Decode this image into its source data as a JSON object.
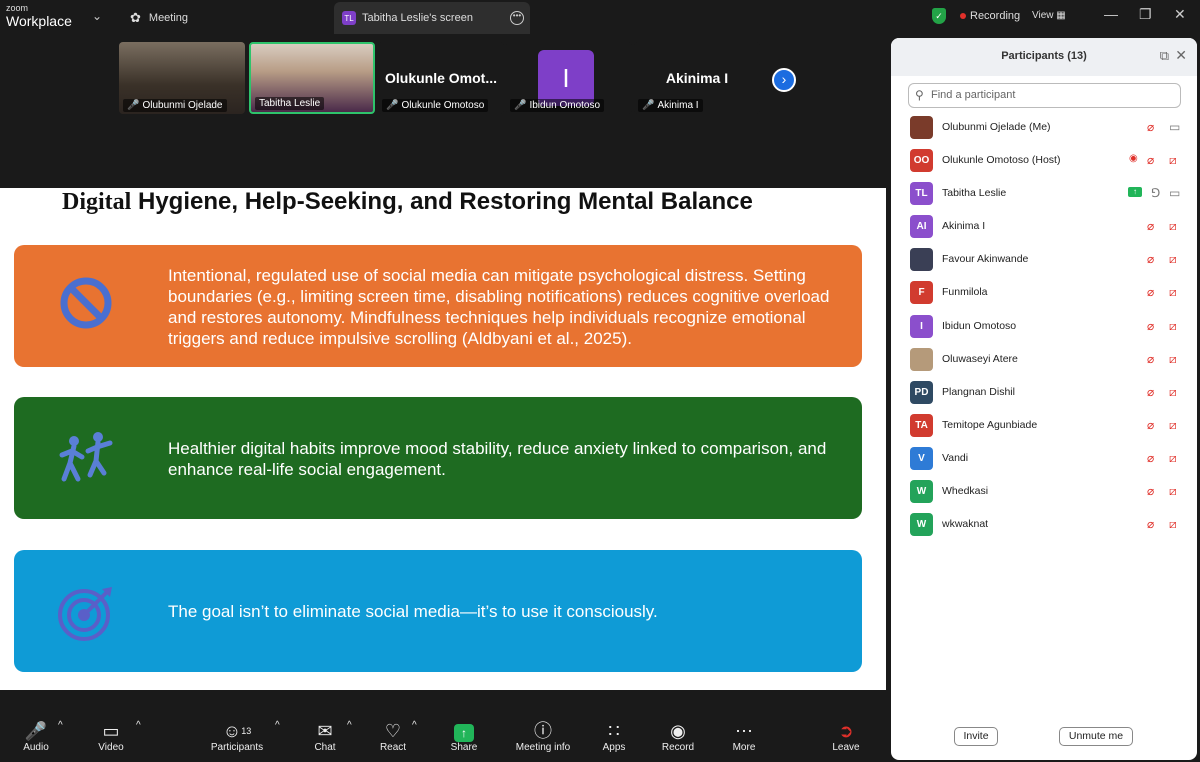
{
  "app": {
    "zoom": "zoom",
    "workplace": "Workplace"
  },
  "tabs": {
    "meeting": "Meeting",
    "screen": "Tabitha Leslie's screen",
    "screen_badge": "TL"
  },
  "top_right": {
    "recording": "Recording",
    "view": "View"
  },
  "video_tiles": [
    {
      "name": "Olubunmi Ojelade"
    },
    {
      "name": "Tabitha Leslie"
    },
    {
      "name": "Olukunle Omotoso",
      "display": "Olukunle  Omot..."
    },
    {
      "name": "Ibidun Omotoso",
      "initial": "I"
    },
    {
      "name": "Akinima I",
      "display": "Akinima I"
    }
  ],
  "slide": {
    "title_serif": "Digital",
    "title_rest": " Hygiene, Help-Seeking, and Restoring Mental Balance",
    "cards": [
      {
        "text": "Intentional, regulated use of social media can mitigate psychological distress. Setting boundaries (e.g., limiting screen time, disabling notifications) reduces cognitive overload and restores autonomy. Mindfulness techniques help individuals recognize emotional triggers and reduce impulsive scrolling (Aldbyani et al., 2025).",
        "icon": "no-symbol-icon",
        "color": "#e87331"
      },
      {
        "text": "Healthier digital habits improve mood stability, reduce anxiety linked to comparison, and enhance real-life social engagement.",
        "icon": "dancing-people-icon",
        "color": "#1e6b21"
      },
      {
        "text": "The goal isn’t to eliminate social media—it’s to use it consciously.",
        "icon": "target-icon",
        "color": "#0f9bd6"
      }
    ]
  },
  "toolbar": {
    "audio": "Audio",
    "video": "Video",
    "participants": "Participants",
    "participants_count": "13",
    "chat": "Chat",
    "react": "React",
    "share": "Share",
    "meeting_info": "Meeting info",
    "apps": "Apps",
    "record": "Record",
    "more": "More",
    "leave": "Leave"
  },
  "panel": {
    "title": "Participants (13)",
    "search_placeholder": "Find a participant",
    "invite": "Invite",
    "unmute_me": "Unmute me",
    "participants": [
      {
        "name": "Olubunmi Ojelade (Me)",
        "initials": "",
        "color": "#7a3b2a",
        "mic": "off",
        "cam": "on"
      },
      {
        "name": "Olukunle Omotoso (Host)",
        "initials": "OO",
        "color": "#d13b2f",
        "mic": "off",
        "cam": "off",
        "recording": true
      },
      {
        "name": "Tabitha Leslie",
        "initials": "TL",
        "color": "#8b4fcc",
        "mic": "on",
        "cam": "on",
        "sharing": true
      },
      {
        "name": "Akinima I",
        "initials": "AI",
        "color": "#8b4fcc",
        "mic": "off",
        "cam": "off"
      },
      {
        "name": "Favour Akinwande",
        "initials": "",
        "color": "#3a3f55",
        "mic": "off",
        "cam": "off"
      },
      {
        "name": "Funmilola",
        "initials": "F",
        "color": "#d13b2f",
        "mic": "off",
        "cam": "off"
      },
      {
        "name": "Ibidun Omotoso",
        "initials": "I",
        "color": "#8b4fcc",
        "mic": "off",
        "cam": "off"
      },
      {
        "name": "Oluwaseyi Atere",
        "initials": "",
        "color": "#b59a7a",
        "mic": "off",
        "cam": "off"
      },
      {
        "name": "Plangnan Dishil",
        "initials": "PD",
        "color": "#2f4a63",
        "mic": "off",
        "cam": "off"
      },
      {
        "name": "Temitope Agunbiade",
        "initials": "TA",
        "color": "#d13b2f",
        "mic": "off",
        "cam": "off"
      },
      {
        "name": "Vandi",
        "initials": "V",
        "color": "#2e7bd6",
        "mic": "off",
        "cam": "off"
      },
      {
        "name": "Whedkasi",
        "initials": "W",
        "color": "#23a35a",
        "mic": "off",
        "cam": "off"
      },
      {
        "name": "wkwaknat",
        "initials": "W",
        "color": "#23a35a",
        "mic": "off",
        "cam": "off"
      }
    ]
  }
}
